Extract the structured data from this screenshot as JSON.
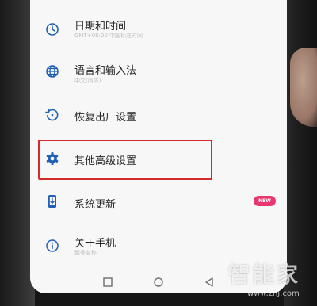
{
  "settings": {
    "items": [
      {
        "icon": "clock-icon",
        "title": "日期和时间",
        "subtitle": "GMT+08:00 中国标准时间"
      },
      {
        "icon": "globe-icon",
        "title": "语言和输入法",
        "subtitle": "中文(简体)"
      },
      {
        "icon": "restore-icon",
        "title": "恢复出厂设置",
        "subtitle": ""
      },
      {
        "icon": "gear-icon",
        "title": "其他高级设置",
        "subtitle": ""
      },
      {
        "icon": "system-update-icon",
        "title": "系统更新",
        "subtitle": ""
      },
      {
        "icon": "info-icon",
        "title": "关于手机",
        "subtitle": "型号名称"
      }
    ],
    "update_badge": "NEW"
  },
  "watermark": {
    "brand": "智能家",
    "url": "www.znj.com"
  },
  "colors": {
    "accent_blue": "#2b6fc6",
    "highlight_red": "#d42a2a",
    "badge_pink": "#e8376f"
  }
}
